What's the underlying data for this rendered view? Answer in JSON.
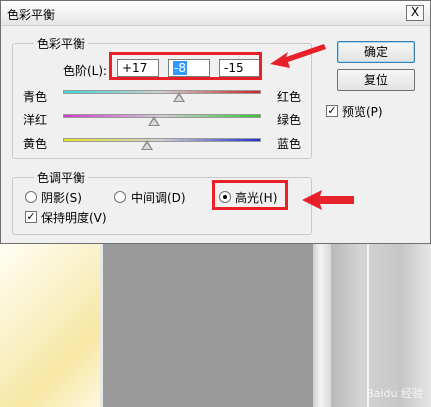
{
  "dialog": {
    "title": "色彩平衡",
    "close_glyph": "X"
  },
  "color_balance": {
    "group_label": "色彩平衡",
    "levels_label": "色阶(L):",
    "levels": [
      "+17",
      "-8",
      "-15"
    ],
    "sliders": [
      {
        "left": "青色",
        "right": "红色",
        "value": 17,
        "colors": [
          "#3ad6d6",
          "#d22020"
        ]
      },
      {
        "left": "洋红",
        "right": "绿色",
        "value": -8,
        "colors": [
          "#d63ad6",
          "#30c830"
        ]
      },
      {
        "left": "黄色",
        "right": "蓝色",
        "value": -15,
        "colors": [
          "#e6e61e",
          "#2030d8"
        ]
      }
    ]
  },
  "tone_balance": {
    "group_label": "色调平衡",
    "options": [
      {
        "label": "阴影(S)",
        "selected": false
      },
      {
        "label": "中间调(D)",
        "selected": false
      },
      {
        "label": "高光(H)",
        "selected": true
      }
    ],
    "preserve_luminosity": {
      "label": "保持明度(V)",
      "checked": true
    }
  },
  "buttons": {
    "ok": "确定",
    "reset": "复位"
  },
  "preview": {
    "label": "预览(P)",
    "checked": true
  },
  "watermark": "Baidu 经验",
  "accent_color": "#e8202a"
}
